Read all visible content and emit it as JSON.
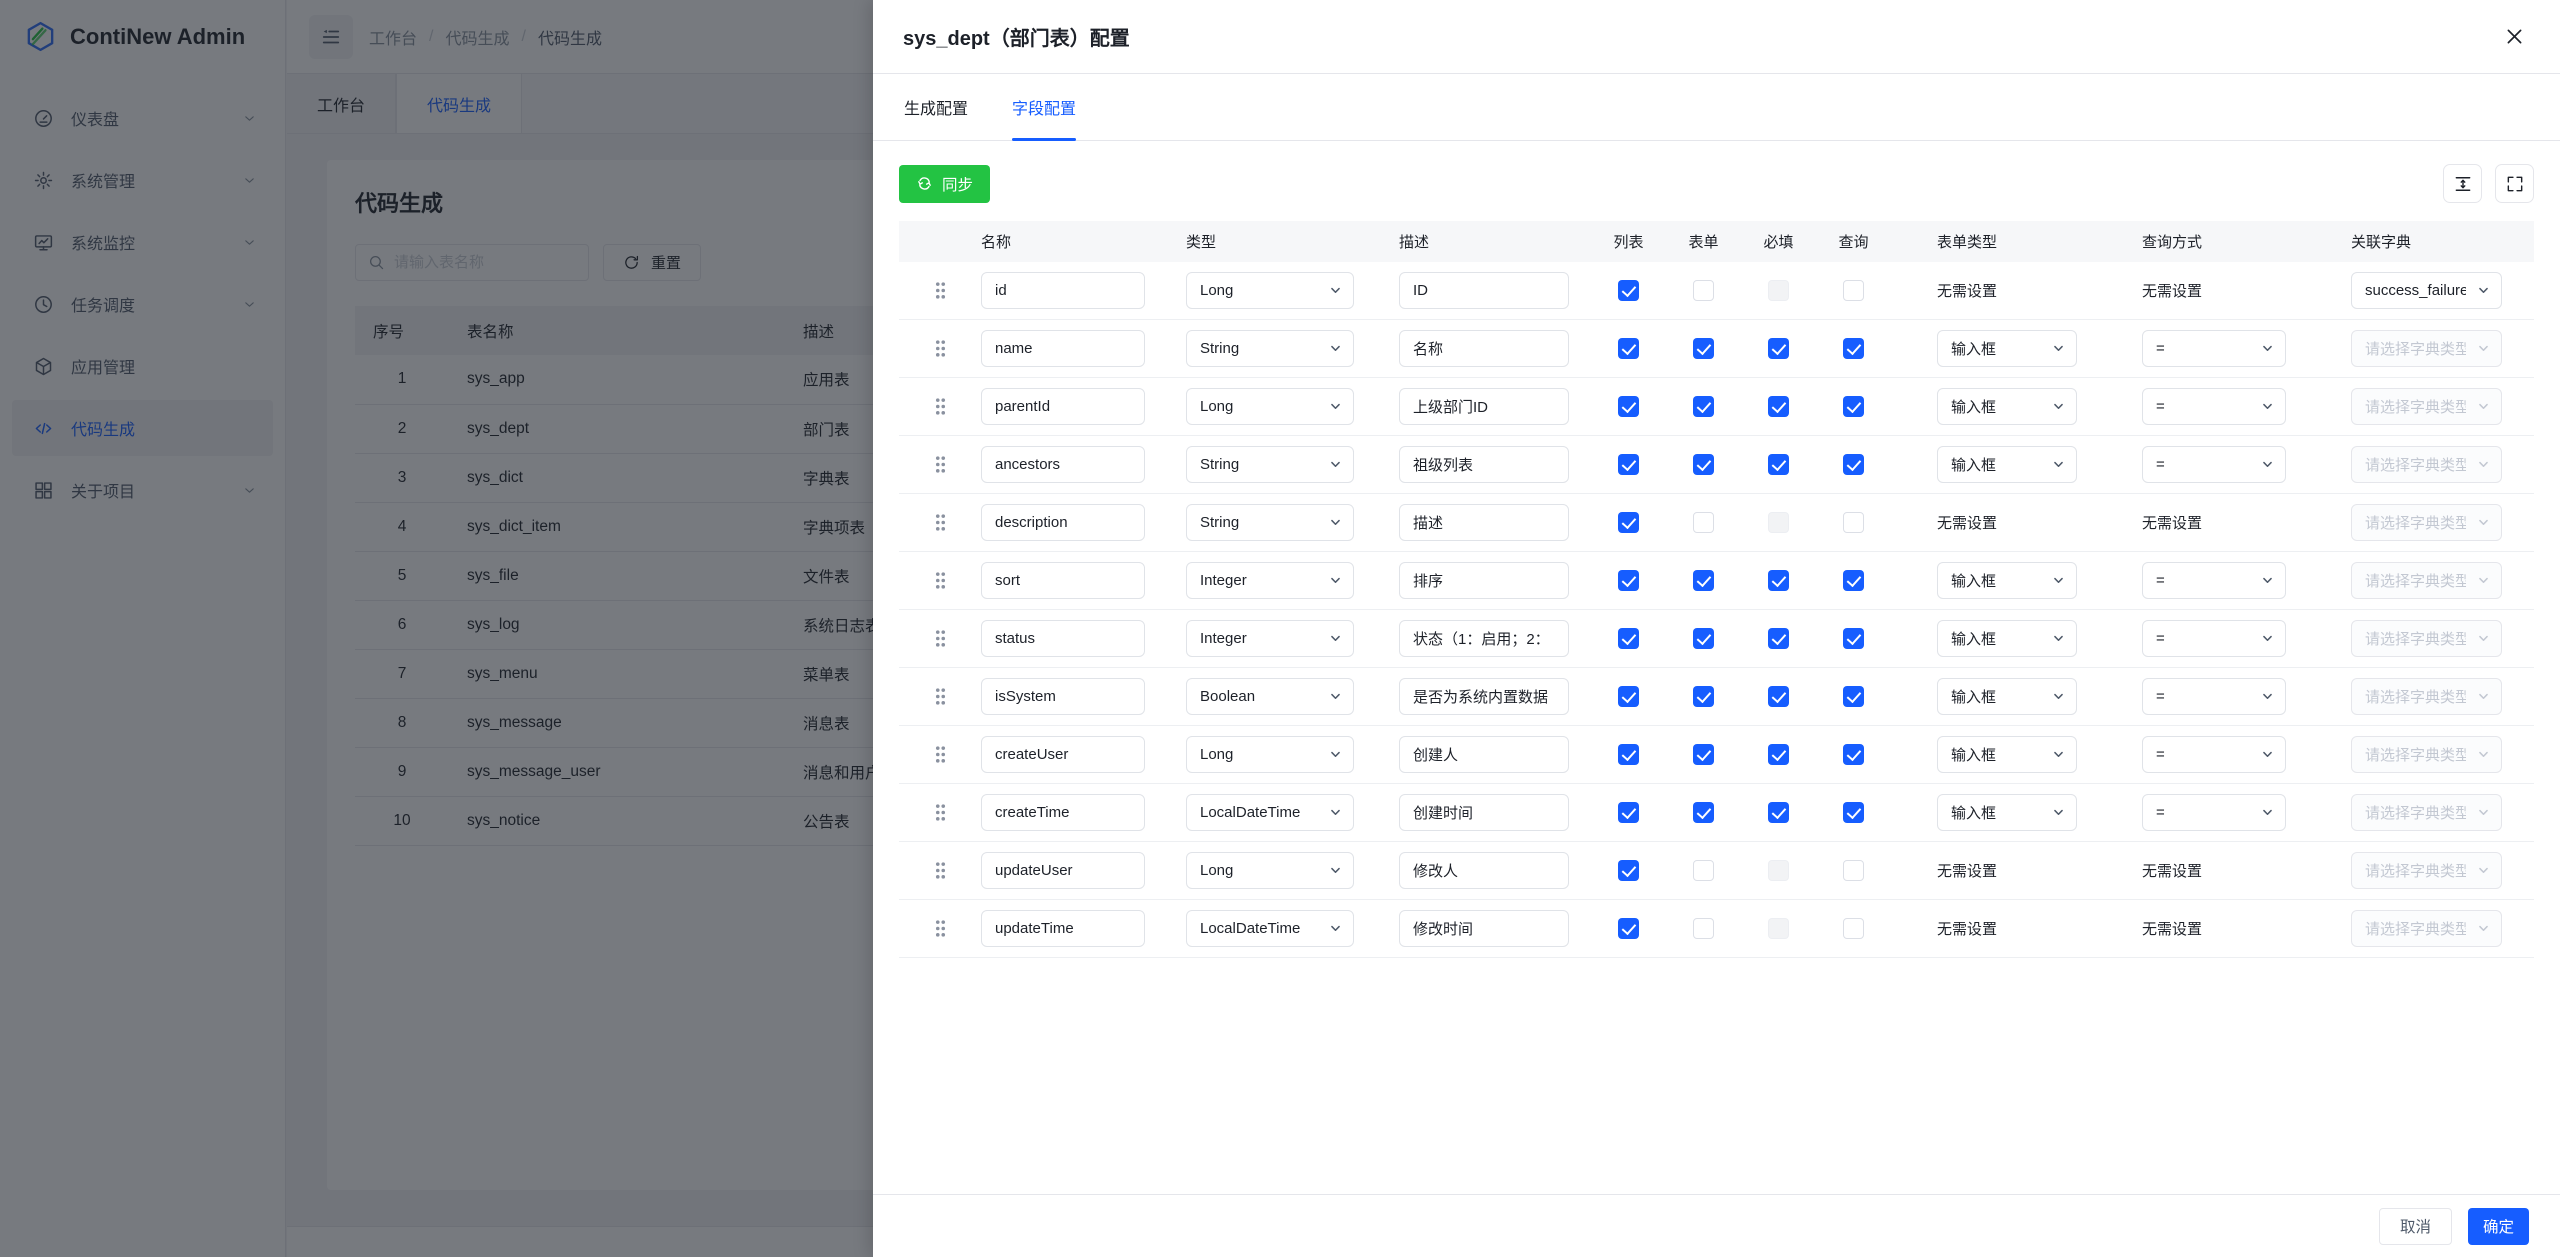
{
  "app": {
    "logo_text": "ContiNew Admin"
  },
  "breadcrumb": {
    "items": [
      "工作台",
      "代码生成",
      "代码生成"
    ]
  },
  "sidebar": {
    "items": [
      {
        "label": "仪表盘",
        "icon": "dashboard-icon",
        "chevron": true,
        "active": false
      },
      {
        "label": "系统管理",
        "icon": "gear-icon",
        "chevron": true,
        "active": false
      },
      {
        "label": "系统监控",
        "icon": "monitor-icon",
        "chevron": true,
        "active": false
      },
      {
        "label": "任务调度",
        "icon": "clock-icon",
        "chevron": true,
        "active": false
      },
      {
        "label": "应用管理",
        "icon": "cube-icon",
        "chevron": false,
        "active": false
      },
      {
        "label": "代码生成",
        "icon": "code-icon",
        "chevron": false,
        "active": true
      },
      {
        "label": "关于项目",
        "icon": "grid-icon",
        "chevron": true,
        "active": false
      }
    ]
  },
  "page_tabs": {
    "items": [
      {
        "label": "工作台",
        "active": false
      },
      {
        "label": "代码生成",
        "active": true
      }
    ]
  },
  "page": {
    "title": "代码生成",
    "search_placeholder": "请输入表名称",
    "reset_label": "重置"
  },
  "tables_list": {
    "columns": [
      "序号",
      "表名称",
      "描述"
    ],
    "rows": [
      [
        "1",
        "sys_app",
        "应用表"
      ],
      [
        "2",
        "sys_dept",
        "部门表"
      ],
      [
        "3",
        "sys_dict",
        "字典表"
      ],
      [
        "4",
        "sys_dict_item",
        "字典项表"
      ],
      [
        "5",
        "sys_file",
        "文件表"
      ],
      [
        "6",
        "sys_log",
        "系统日志表"
      ],
      [
        "7",
        "sys_menu",
        "菜单表"
      ],
      [
        "8",
        "sys_message",
        "消息表"
      ],
      [
        "9",
        "sys_message_user",
        "消息和用户关联表"
      ],
      [
        "10",
        "sys_notice",
        "公告表"
      ]
    ]
  },
  "drawer": {
    "title": "sys_dept（部门表）配置",
    "tabs": [
      {
        "label": "生成配置",
        "active": false
      },
      {
        "label": "字段配置",
        "active": true
      }
    ],
    "sync_label": "同步",
    "columns": [
      "名称",
      "类型",
      "描述",
      "列表",
      "表单",
      "必填",
      "查询",
      "表单类型",
      "查询方式",
      "关联字典"
    ],
    "none_text": "无需设置",
    "dict_placeholder": "请选择字典类型",
    "fields": [
      {
        "name": "id",
        "type": "Long",
        "desc": "ID",
        "list": "checked",
        "form": "unchecked",
        "required": "disabled",
        "query": "unchecked",
        "form_type": {
          "kind": "text",
          "value": "无需设置"
        },
        "query_type": {
          "kind": "text",
          "value": "无需设置"
        },
        "dict": {
          "kind": "select",
          "value": "success_failure",
          "disabled": false
        }
      },
      {
        "name": "name",
        "type": "String",
        "desc": "名称",
        "list": "checked",
        "form": "checked",
        "required": "checked",
        "query": "checked",
        "form_type": {
          "kind": "select",
          "value": "输入框"
        },
        "query_type": {
          "kind": "select",
          "value": "="
        },
        "dict": {
          "kind": "select",
          "value": "请选择字典类型",
          "disabled": true
        }
      },
      {
        "name": "parentId",
        "type": "Long",
        "desc": "上级部门ID",
        "list": "checked",
        "form": "checked",
        "required": "checked",
        "query": "checked",
        "form_type": {
          "kind": "select",
          "value": "输入框"
        },
        "query_type": {
          "kind": "select",
          "value": "="
        },
        "dict": {
          "kind": "select",
          "value": "请选择字典类型",
          "disabled": true
        }
      },
      {
        "name": "ancestors",
        "type": "String",
        "desc": "祖级列表",
        "list": "checked",
        "form": "checked",
        "required": "checked",
        "query": "checked",
        "form_type": {
          "kind": "select",
          "value": "输入框"
        },
        "query_type": {
          "kind": "select",
          "value": "="
        },
        "dict": {
          "kind": "select",
          "value": "请选择字典类型",
          "disabled": true
        }
      },
      {
        "name": "description",
        "type": "String",
        "desc": "描述",
        "list": "checked",
        "form": "unchecked",
        "required": "disabled",
        "query": "unchecked",
        "form_type": {
          "kind": "text",
          "value": "无需设置"
        },
        "query_type": {
          "kind": "text",
          "value": "无需设置"
        },
        "dict": {
          "kind": "select",
          "value": "请选择字典类型",
          "disabled": true
        }
      },
      {
        "name": "sort",
        "type": "Integer",
        "desc": "排序",
        "list": "checked",
        "form": "checked",
        "required": "checked",
        "query": "checked",
        "form_type": {
          "kind": "select",
          "value": "输入框"
        },
        "query_type": {
          "kind": "select",
          "value": "="
        },
        "dict": {
          "kind": "select",
          "value": "请选择字典类型",
          "disabled": true
        }
      },
      {
        "name": "status",
        "type": "Integer",
        "desc": "状态（1：启用；2：",
        "list": "checked",
        "form": "checked",
        "required": "checked",
        "query": "checked",
        "form_type": {
          "kind": "select",
          "value": "输入框"
        },
        "query_type": {
          "kind": "select",
          "value": "="
        },
        "dict": {
          "kind": "select",
          "value": "请选择字典类型",
          "disabled": true
        }
      },
      {
        "name": "isSystem",
        "type": "Boolean",
        "desc": "是否为系统内置数据",
        "list": "checked",
        "form": "checked",
        "required": "checked",
        "query": "checked",
        "form_type": {
          "kind": "select",
          "value": "输入框"
        },
        "query_type": {
          "kind": "select",
          "value": "="
        },
        "dict": {
          "kind": "select",
          "value": "请选择字典类型",
          "disabled": true
        }
      },
      {
        "name": "createUser",
        "type": "Long",
        "desc": "创建人",
        "list": "checked",
        "form": "checked",
        "required": "checked",
        "query": "checked",
        "form_type": {
          "kind": "select",
          "value": "输入框"
        },
        "query_type": {
          "kind": "select",
          "value": "="
        },
        "dict": {
          "kind": "select",
          "value": "请选择字典类型",
          "disabled": true
        }
      },
      {
        "name": "createTime",
        "type": "LocalDateTime",
        "desc": "创建时间",
        "list": "checked",
        "form": "checked",
        "required": "checked",
        "query": "checked",
        "form_type": {
          "kind": "select",
          "value": "输入框"
        },
        "query_type": {
          "kind": "select",
          "value": "="
        },
        "dict": {
          "kind": "select",
          "value": "请选择字典类型",
          "disabled": true
        }
      },
      {
        "name": "updateUser",
        "type": "Long",
        "desc": "修改人",
        "list": "checked",
        "form": "unchecked",
        "required": "disabled",
        "query": "unchecked",
        "form_type": {
          "kind": "text",
          "value": "无需设置"
        },
        "query_type": {
          "kind": "text",
          "value": "无需设置"
        },
        "dict": {
          "kind": "select",
          "value": "请选择字典类型",
          "disabled": true
        }
      },
      {
        "name": "updateTime",
        "type": "LocalDateTime",
        "desc": "修改时间",
        "list": "checked",
        "form": "unchecked",
        "required": "disabled",
        "query": "unchecked",
        "form_type": {
          "kind": "text",
          "value": "无需设置"
        },
        "query_type": {
          "kind": "text",
          "value": "无需设置"
        },
        "dict": {
          "kind": "select",
          "value": "请选择字典类型",
          "disabled": true
        }
      }
    ],
    "footer": {
      "cancel": "取消",
      "ok": "确定"
    }
  },
  "colors": {
    "primary": "#165DFF",
    "success_green": "#23C343",
    "mask": "rgba(29,33,41,0.6)",
    "border": "#e5e6eb",
    "header_bg": "#f6f7f9"
  }
}
